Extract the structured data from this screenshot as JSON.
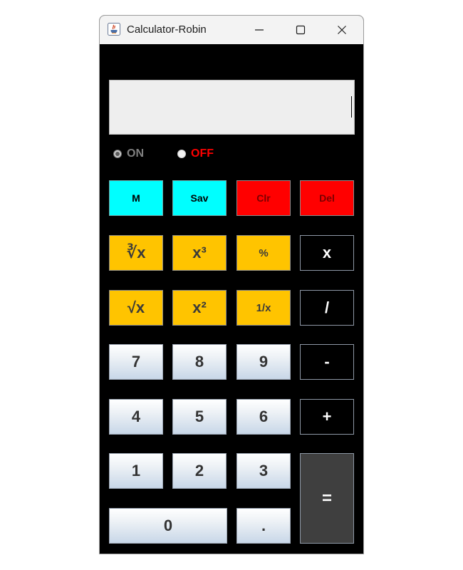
{
  "window": {
    "title": "Calculator-Robin",
    "controls": {
      "minimize": "—",
      "maximize": "☐",
      "close": "✕"
    }
  },
  "display": {
    "value": ""
  },
  "power": {
    "on_label": "ON",
    "off_label": "OFF",
    "selected": "ON",
    "on_color": "#808080",
    "off_color": "#ff0000"
  },
  "buttons": {
    "memory": "M",
    "save": "Sav",
    "clear": "Clr",
    "delete": "Del",
    "cube_root": "∛x",
    "cube": "x³",
    "percent": "%",
    "multiply": "x",
    "sqrt": "√x",
    "square": "x²",
    "reciprocal": "1/x",
    "divide": "/",
    "seven": "7",
    "eight": "8",
    "nine": "9",
    "subtract": "-",
    "four": "4",
    "five": "5",
    "six": "6",
    "add": "+",
    "one": "1",
    "two": "2",
    "three": "3",
    "equals": "=",
    "zero": "0",
    "decimal": "."
  },
  "colors": {
    "cyan": "#00ffff",
    "red": "#ff0000",
    "gold": "#ffc400",
    "background": "#000000",
    "equals": "#3f3f3f"
  }
}
